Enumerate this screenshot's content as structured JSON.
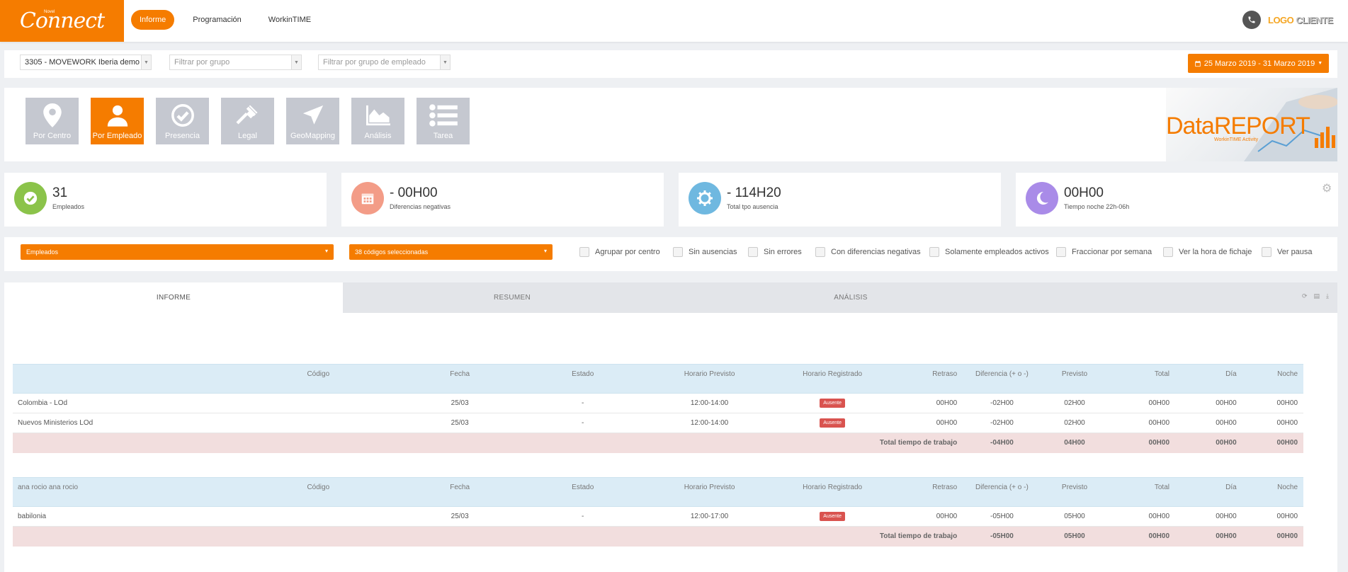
{
  "brand": {
    "logo_text": "Connect",
    "logo_small": "Novel",
    "client_logo_a": "LOGO",
    "client_logo_b": "CLIENTE"
  },
  "nav": {
    "items": [
      "Informe",
      "Programación",
      "WorkinTIME"
    ]
  },
  "filters": {
    "company": "3305 - MOVEWORK Iberia demo",
    "group_placeholder": "Filtrar por grupo",
    "employee_group_placeholder": "Filtrar por grupo de empleado",
    "date_range": "25 Marzo 2019 - 31 Marzo 2019"
  },
  "report_types": [
    "Por Centro",
    "Por Empleado",
    "Presencia",
    "Legal",
    "GeoMapping",
    "Análisis",
    "Tarea"
  ],
  "datareport": {
    "title_a": "Data",
    "title_b": "REPORT",
    "subtitle": "WorkinTIME Activity"
  },
  "stats": [
    {
      "value": "31",
      "label": "Empleados",
      "color": "#8bc34a"
    },
    {
      "value": "- 00H00",
      "label": "Diferencias negativas",
      "color": "#f39c87"
    },
    {
      "value": "- 114H20",
      "label": "Total tpo ausencia",
      "color": "#6fb8e0"
    },
    {
      "value": "00H00",
      "label": "Tiempo noche 22h-06h",
      "color": "#a98be8"
    }
  ],
  "options": {
    "select_1": "Empleados",
    "select_2": "38 códigos seleccionadas",
    "checkboxes": [
      "Agrupar por centro",
      "Sin ausencias",
      "Sin errores",
      "Con diferencias negativas",
      "Solamente empleados activos",
      "Fraccionar por semana",
      "Ver la hora de fichaje",
      "Ver pausa"
    ]
  },
  "tabs": [
    "INFORME",
    "RESUMEN",
    "ANÁLISIS"
  ],
  "columns": [
    "Código",
    "Fecha",
    "Estado",
    "Horario Previsto",
    "Horario Registrado",
    "Retraso",
    "Diferencia (+ o -)",
    "Previsto",
    "Total",
    "Día",
    "Noche"
  ],
  "groups": [
    {
      "name": "",
      "rows": [
        {
          "name": "Colombia - LOd",
          "codigo": "",
          "fecha": "25/03",
          "estado": "-",
          "previsto_h": "12:00-14:00",
          "registrado": "Ausente",
          "retraso": "00H00",
          "diferencia": "-02H00",
          "previsto": "02H00",
          "total": "00H00",
          "dia": "00H00",
          "noche": "00H00"
        },
        {
          "name": "Nuevos Ministerios LOd",
          "codigo": "",
          "fecha": "25/03",
          "estado": "-",
          "previsto_h": "12:00-14:00",
          "registrado": "Ausente",
          "retraso": "00H00",
          "diferencia": "-02H00",
          "previsto": "02H00",
          "total": "00H00",
          "dia": "00H00",
          "noche": "00H00"
        }
      ],
      "total": {
        "label": "Total tiempo de trabajo",
        "diferencia": "-04H00",
        "previsto": "04H00",
        "total": "00H00",
        "dia": "00H00",
        "noche": "00H00"
      }
    },
    {
      "name": "ana rocio ana rocio",
      "rows": [
        {
          "name": "babilonia",
          "codigo": "",
          "fecha": "25/03",
          "estado": "-",
          "previsto_h": "12:00-17:00",
          "registrado": "Ausente",
          "retraso": "00H00",
          "diferencia": "-05H00",
          "previsto": "05H00",
          "total": "00H00",
          "dia": "00H00",
          "noche": "00H00"
        }
      ],
      "total": {
        "label": "Total tiempo de trabajo",
        "diferencia": "-05H00",
        "previsto": "05H00",
        "total": "00H00",
        "dia": "00H00",
        "noche": "00H00"
      }
    }
  ]
}
